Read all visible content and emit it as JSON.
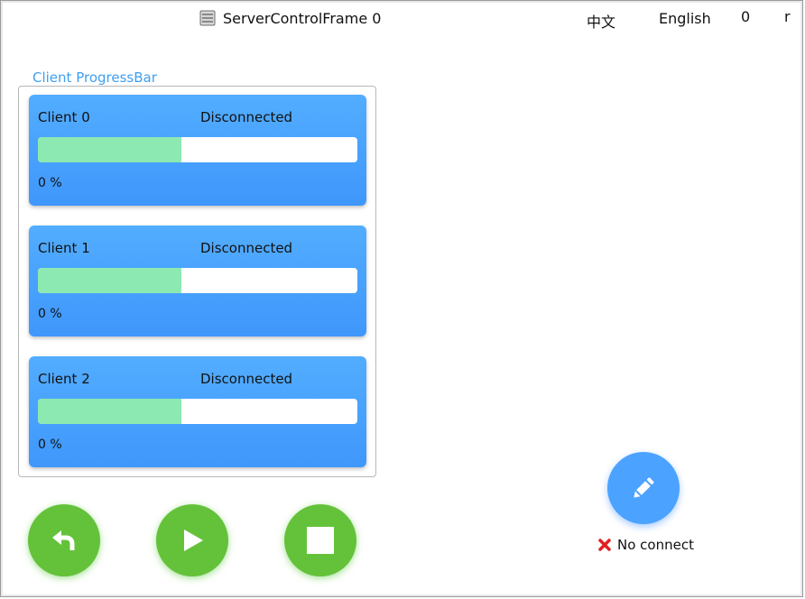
{
  "header": {
    "title": "ServerControlFrame 0",
    "title_icon": "server-icon",
    "lang_cn": "中文",
    "lang_en": "English",
    "counter": "0",
    "extra": "r"
  },
  "group": {
    "legend": "Client ProgressBar"
  },
  "clients": [
    {
      "name": "Client 0",
      "status": "Disconnected",
      "progress_label": "0 %",
      "bar_fill_fraction": 0.45
    },
    {
      "name": "Client 1",
      "status": "Disconnected",
      "progress_label": "0 %",
      "bar_fill_fraction": 0.45
    },
    {
      "name": "Client 2",
      "status": "Disconnected",
      "progress_label": "0 %",
      "bar_fill_fraction": 0.45
    }
  ],
  "controls": {
    "buttons": [
      {
        "icon": "undo-arrow-icon"
      },
      {
        "icon": "play-icon"
      },
      {
        "icon": "stop-icon"
      }
    ],
    "edit_icon": "pencil-icon",
    "connection_status": "No connect",
    "connection_icon": "x-mark-icon"
  },
  "colors": {
    "card_blue": "#4aa3fe",
    "progress_green": "#8ce9b1",
    "button_green": "#64c23a",
    "edit_blue": "#4ca2ff",
    "legend_blue": "#3f9ff1",
    "error_red": "#e02020"
  }
}
